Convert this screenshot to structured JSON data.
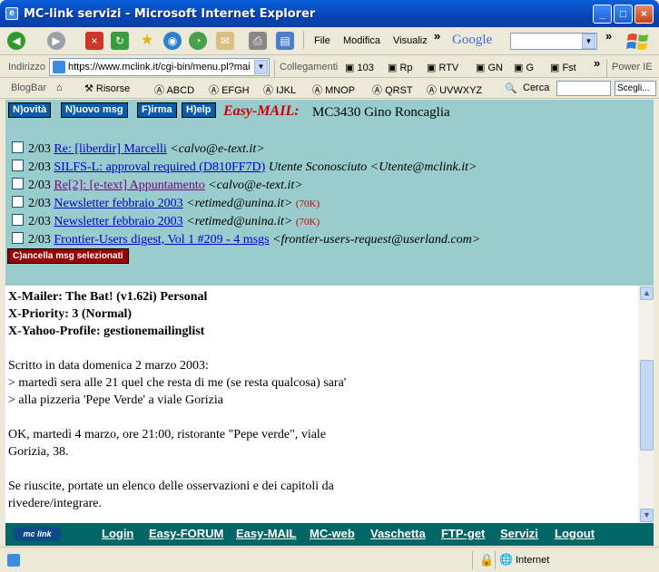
{
  "window": {
    "title": "MC-link servizi - Microsoft Internet Explorer"
  },
  "menubar": {
    "items": [
      "File",
      "Modifica",
      "Visualiz"
    ]
  },
  "google": {
    "label": "Google"
  },
  "address": {
    "label": "Indirizzo",
    "url": "https://www.mclink.it/cgi-bin/menu.pl?mai"
  },
  "links": {
    "label": "Collegamenti",
    "items": [
      "103",
      "Rp",
      "RTV",
      "GN",
      "G",
      "Fst"
    ],
    "power": "Power IE"
  },
  "blogbar": {
    "label": "BlogBar",
    "risorse": "Risorse",
    "items": [
      "ABCD",
      "EFGH",
      "IJKL",
      "MNOP",
      "QRST",
      "UVWXYZ"
    ],
    "search_label": "Cerca",
    "select": "Scegli..."
  },
  "mail": {
    "buttons": [
      "N)ovità",
      "N)uovo msg",
      "F)irma",
      "H)elp"
    ],
    "brand": "Easy-MAIL:",
    "owner": "MC3430 Gino Roncaglia",
    "messages": [
      {
        "date": "2/03",
        "subject": "Re: [liberdir] Marcelli",
        "from": "<calvo@e-text.it>",
        "size": ""
      },
      {
        "date": "2/03",
        "subject": "SILFS-L: approval required (D810FF7D)",
        "from": "Utente Sconosciuto <Utente@mclink.it>",
        "size": ""
      },
      {
        "date": "2/03",
        "subject": "Re[2]: [e-text] Appuntamento",
        "from": "<calvo@e-text.it>",
        "size": ""
      },
      {
        "date": "2/03",
        "subject": "Newsletter febbraio 2003",
        "from": "<retimed@unina.it>",
        "size": "(70K)"
      },
      {
        "date": "2/03",
        "subject": "Newsletter febbraio 2003",
        "from": "<retimed@unina.it>",
        "size": "(70K)"
      },
      {
        "date": "2/03",
        "subject": "Frontier-Users digest, Vol 1 #209 - 4 msgs",
        "from": "<frontier-users-request@userland.com>",
        "size": ""
      }
    ],
    "delete_button": "C)ancella msg selezionati"
  },
  "body": {
    "headers": [
      "X-Mailer: The Bat! (v1.62i) Personal",
      "X-Priority: 3 (Normal)",
      "X-Yahoo-Profile: gestionemailinglist"
    ],
    "lines": [
      "Scritto in data domenica 2 marzo 2003:",
      "> martedì sera alle 21 quel che resta di me (se resta qualcosa) sara'",
      "> alla pizzeria 'Pepe Verde' a viale Gorizia",
      "",
      "OK, martedì 4 marzo, ore 21:00, ristorante \"Pepe verde\", viale",
      "Gorizia, 38.",
      "",
      "Se riuscite, portate un elenco delle osservazioni e dei capitoli da",
      "rivedere/integrare."
    ]
  },
  "footer": {
    "logo": "mc link",
    "links": [
      "Login",
      "Easy-FORUM",
      "Easy-MAIL",
      "MC-web",
      "Vaschetta",
      "FTP-get",
      "Servizi",
      "Logout"
    ]
  },
  "status": {
    "zone": "Internet"
  }
}
